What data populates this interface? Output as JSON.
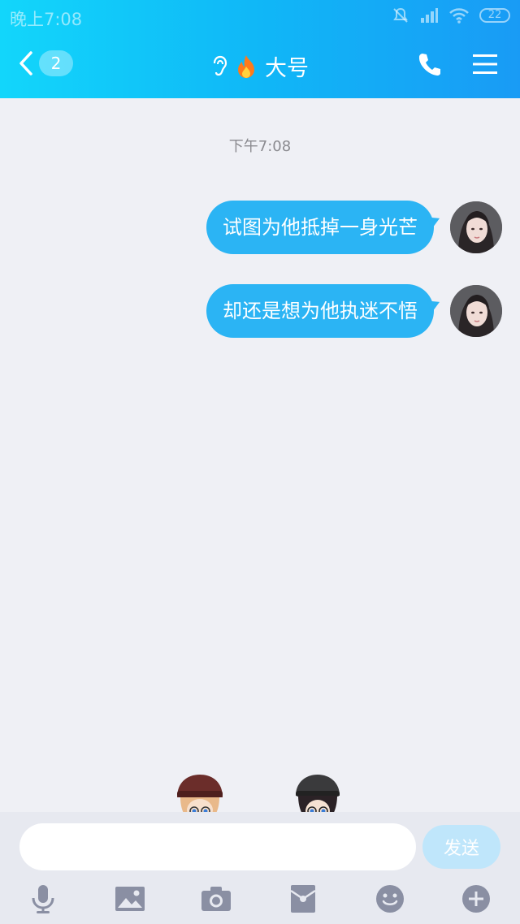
{
  "status": {
    "time": "晚上7:08",
    "battery": "22"
  },
  "header": {
    "back_count": "2",
    "title": "大号"
  },
  "chat": {
    "timestamp": "下午7:08",
    "messages": [
      {
        "text": "试图为他抵掉一身光芒"
      },
      {
        "text": "却还是想为他执迷不悟"
      }
    ]
  },
  "composer": {
    "placeholder": "",
    "send_label": "发送"
  },
  "toolbar": [
    "mic-icon",
    "image-icon",
    "camera-icon",
    "red-packet-icon",
    "emoji-icon",
    "plus-icon"
  ],
  "colors": {
    "header_start": "#12d6fb",
    "header_end": "#199bf5",
    "bubble": "#2bb4f4",
    "background": "#eff0f5"
  }
}
